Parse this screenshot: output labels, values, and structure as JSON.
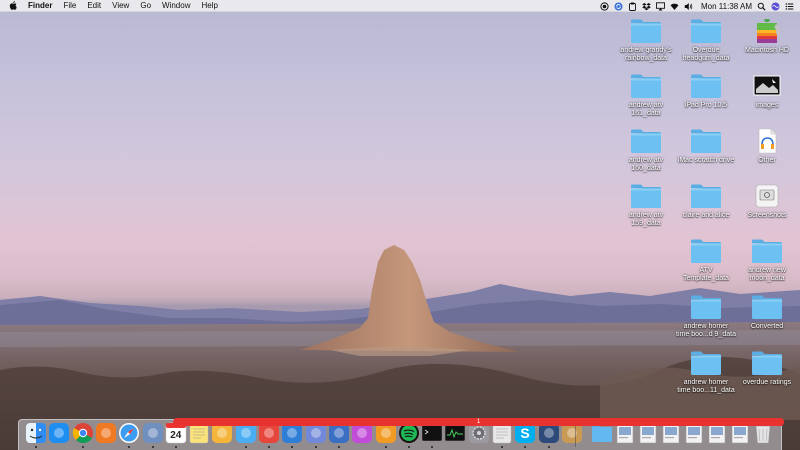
{
  "menubar": {
    "app_name": "Finder",
    "items": [
      "File",
      "Edit",
      "View",
      "Go",
      "Window",
      "Help"
    ],
    "clock": "Mon 11:38 AM",
    "status_icons": [
      "record-icon",
      "sync-icon",
      "clipboard-icon",
      "dropbox-icon",
      "airplay-icon",
      "wifi-icon",
      "volume-icon",
      "spotlight-icon",
      "siri-icon",
      "notification-center-icon"
    ]
  },
  "desktop": {
    "icons": [
      {
        "label": "andrew grandy's\nrainbow_data",
        "type": "folder"
      },
      {
        "label": "Overdue\nheadgum_data",
        "type": "folder"
      },
      {
        "label": "Macintosh HD",
        "type": "drive"
      },
      {
        "label": "andrew atv\n161_data",
        "type": "folder"
      },
      {
        "label": "iPad Pro 10.5",
        "type": "folder"
      },
      {
        "label": "images",
        "type": "image-doc"
      },
      {
        "label": "andrew atv\n160_data",
        "type": "folder"
      },
      {
        "label": "iMac scratch drive",
        "type": "folder"
      },
      {
        "label": "Other",
        "type": "audio-doc"
      },
      {
        "label": "andrew atv\n159_data",
        "type": "folder"
      },
      {
        "label": "claire and alice",
        "type": "folder"
      },
      {
        "label": "Screenshots",
        "type": "screenshots-doc"
      },
      {
        "label": "ATV\nTemplate_data",
        "type": "folder"
      },
      {
        "label": "andrew new\nmoon_data",
        "type": "folder"
      },
      {
        "label": "andrew homer\ntime boo...d 9_data",
        "type": "folder"
      },
      {
        "label": "Converted",
        "type": "folder"
      },
      {
        "label": "andrew homer\ntime boo...11_data",
        "type": "folder"
      },
      {
        "label": "overdue ratings",
        "type": "folder"
      }
    ]
  },
  "dock": {
    "calendar_date": "24",
    "badges": {
      "mail": "1",
      "messages": "1",
      "skitch": "2"
    },
    "apps": [
      {
        "name": "finder-icon",
        "color": "#2f8cf0"
      },
      {
        "name": "app-store-icon",
        "color": "#1f8ef1"
      },
      {
        "name": "chrome-icon",
        "color": "#e0442f"
      },
      {
        "name": "firefox-icon",
        "color": "#f07a23"
      },
      {
        "name": "safari-icon",
        "color": "#3b9cf2"
      },
      {
        "name": "preview-icon",
        "color": "#6f8fbf"
      },
      {
        "name": "calendar-icon",
        "color": "#ffffff"
      },
      {
        "name": "notes-icon",
        "color": "#fbe37a"
      },
      {
        "name": "photos-icon",
        "color": "#f5b53a"
      },
      {
        "name": "messages-icon",
        "color": "#4caef2"
      },
      {
        "name": "skitch-icon",
        "color": "#e6463c"
      },
      {
        "name": "airmail-icon",
        "color": "#2f7fd8"
      },
      {
        "name": "discord-icon",
        "color": "#7289da"
      },
      {
        "name": "slack-icon",
        "color": "#3b6fc4"
      },
      {
        "name": "podcast-icon",
        "color": "#c14cd8"
      },
      {
        "name": "audio-hijack-icon",
        "color": "#f29b24"
      },
      {
        "name": "spotify-icon",
        "color": "#1db954"
      },
      {
        "name": "terminal-icon",
        "color": "#2b2b2b"
      },
      {
        "name": "activity-monitor-icon",
        "color": "#333333"
      },
      {
        "name": "system-preferences-icon",
        "color": "#8e8e93"
      },
      {
        "name": "script-editor-icon",
        "color": "#e8e8e8"
      },
      {
        "name": "skype-icon",
        "color": "#00aff0"
      },
      {
        "name": "quicktime-icon",
        "color": "#2e4a7a"
      },
      {
        "name": "archive-utility-icon",
        "color": "#c99a53"
      },
      {
        "name": "downloads-folder-icon",
        "color": "#64b8f0"
      },
      {
        "name": "document-stack-icon",
        "color": "#f2f2f2"
      },
      {
        "name": "document-stack-icon-2",
        "color": "#f2f2f2"
      },
      {
        "name": "screenshot-stack-icon",
        "color": "#f2f2f2"
      },
      {
        "name": "screenshot-stack-icon-2",
        "color": "#f2f2f2"
      },
      {
        "name": "screenshot-stack-icon-3",
        "color": "#f2f2f2"
      },
      {
        "name": "screenshot-stack-icon-4",
        "color": "#f2f2f2"
      },
      {
        "name": "trash-icon",
        "color": "#d6d6d6"
      }
    ]
  },
  "colors": {
    "folder": "#6cc0f2",
    "folder_tab": "#5aaee3",
    "rock": "#b8876a"
  }
}
